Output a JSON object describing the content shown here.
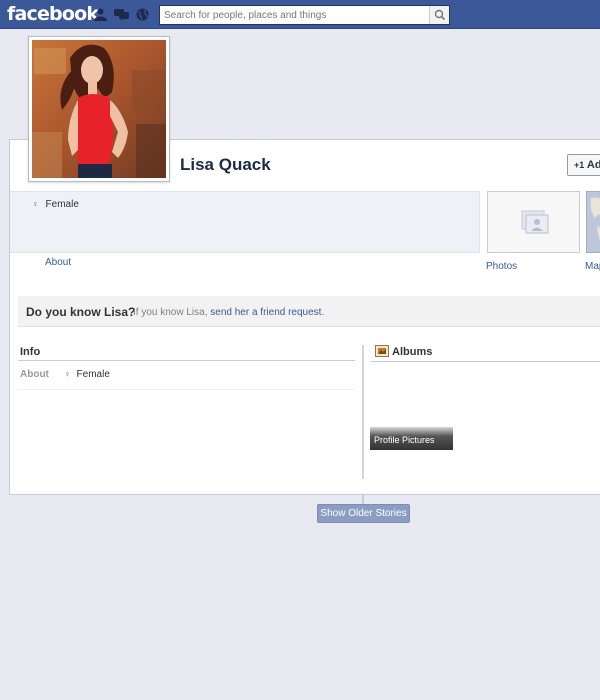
{
  "header": {
    "logo": "facebook",
    "search_placeholder": "Search for people, places and things"
  },
  "profile": {
    "name": "Lisa Quack",
    "add_button_label": "Ad"
  },
  "intro": {
    "gender": "Female",
    "about_link": "About"
  },
  "media": {
    "photos_label": "Photos",
    "map_label": "Map"
  },
  "know_prompt": {
    "title": "Do you know Lisa?",
    "text_prefix": "If you know Lisa, ",
    "link": "send her a friend request",
    "text_suffix": "."
  },
  "info_section": {
    "heading": "Info",
    "about_label": "About",
    "about_value": "Female"
  },
  "albums_section": {
    "heading": "Albums",
    "album_title": "Profile Pictures"
  },
  "timeline": {
    "older_button": "Show Older Stories"
  },
  "colors": {
    "brand": "#3b5998",
    "background": "#e9eaf1",
    "dark_name": "#1c2a47"
  }
}
